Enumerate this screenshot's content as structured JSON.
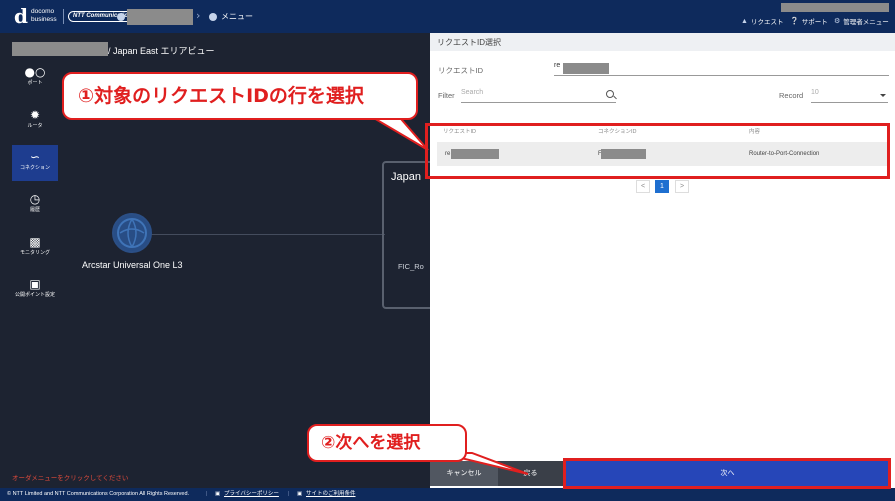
{
  "header": {
    "menu_label": "メニュー",
    "request_label": "リクエスト",
    "support_label": "サポート",
    "admin_label": "管理者メニュー",
    "logo_main": "d",
    "logo_text_line1": "docomo",
    "logo_text_line2": "business",
    "ntt_logo_text": "NTT Communications"
  },
  "map": {
    "breadcrumb": "/ Japan East エリアビュー",
    "globe_label": "Arcstar Universal One L3",
    "box_title": "Japan",
    "box_sub": "FIC_Ro",
    "footer_warning": "オーダメニューをクリックしてください"
  },
  "nav": {
    "items": [
      {
        "label": "ポート",
        "icon": "port-icon"
      },
      {
        "label": "ルータ",
        "icon": "router-icon"
      },
      {
        "label": "コネクション",
        "icon": "connection-icon"
      },
      {
        "label": "履歴",
        "icon": "history-icon"
      },
      {
        "label": "モニタリング",
        "icon": "monitoring-icon"
      },
      {
        "label": "公開ポイント設定",
        "icon": "display-icon"
      }
    ]
  },
  "panel": {
    "title": "リクエストID選択",
    "request_id_label": "リクエストID",
    "request_id_value": "re",
    "filter_label": "Filter",
    "search_placeholder": "Search",
    "record_label": "Record",
    "record_value": "10",
    "columns": [
      "リクエストID",
      "コネクションID",
      "内容"
    ],
    "row": {
      "request_id": "re",
      "connection_id": "F",
      "content": "Router-to-Port-Connection"
    },
    "pagination": {
      "prev": "<",
      "current": "1",
      "next": ">"
    },
    "cancel_label": "キャンセル",
    "back_label": "戻る",
    "next_label": "次へ"
  },
  "footer": {
    "copyright": "© NTT Limited and NTT Communications Corporation All Rights Reserved.",
    "privacy_label": "プライバシーポリシー",
    "terms_label": "サイトのご利用条件"
  },
  "annotations": {
    "step1": "①対象のリクエストIDの行を選択",
    "step2": "②次へを選択"
  },
  "colors": {
    "header_bg": "#0e2a5c",
    "map_bg": "#1d2331",
    "accent_blue": "#2646b8",
    "annotation_red": "#e01f1f"
  }
}
